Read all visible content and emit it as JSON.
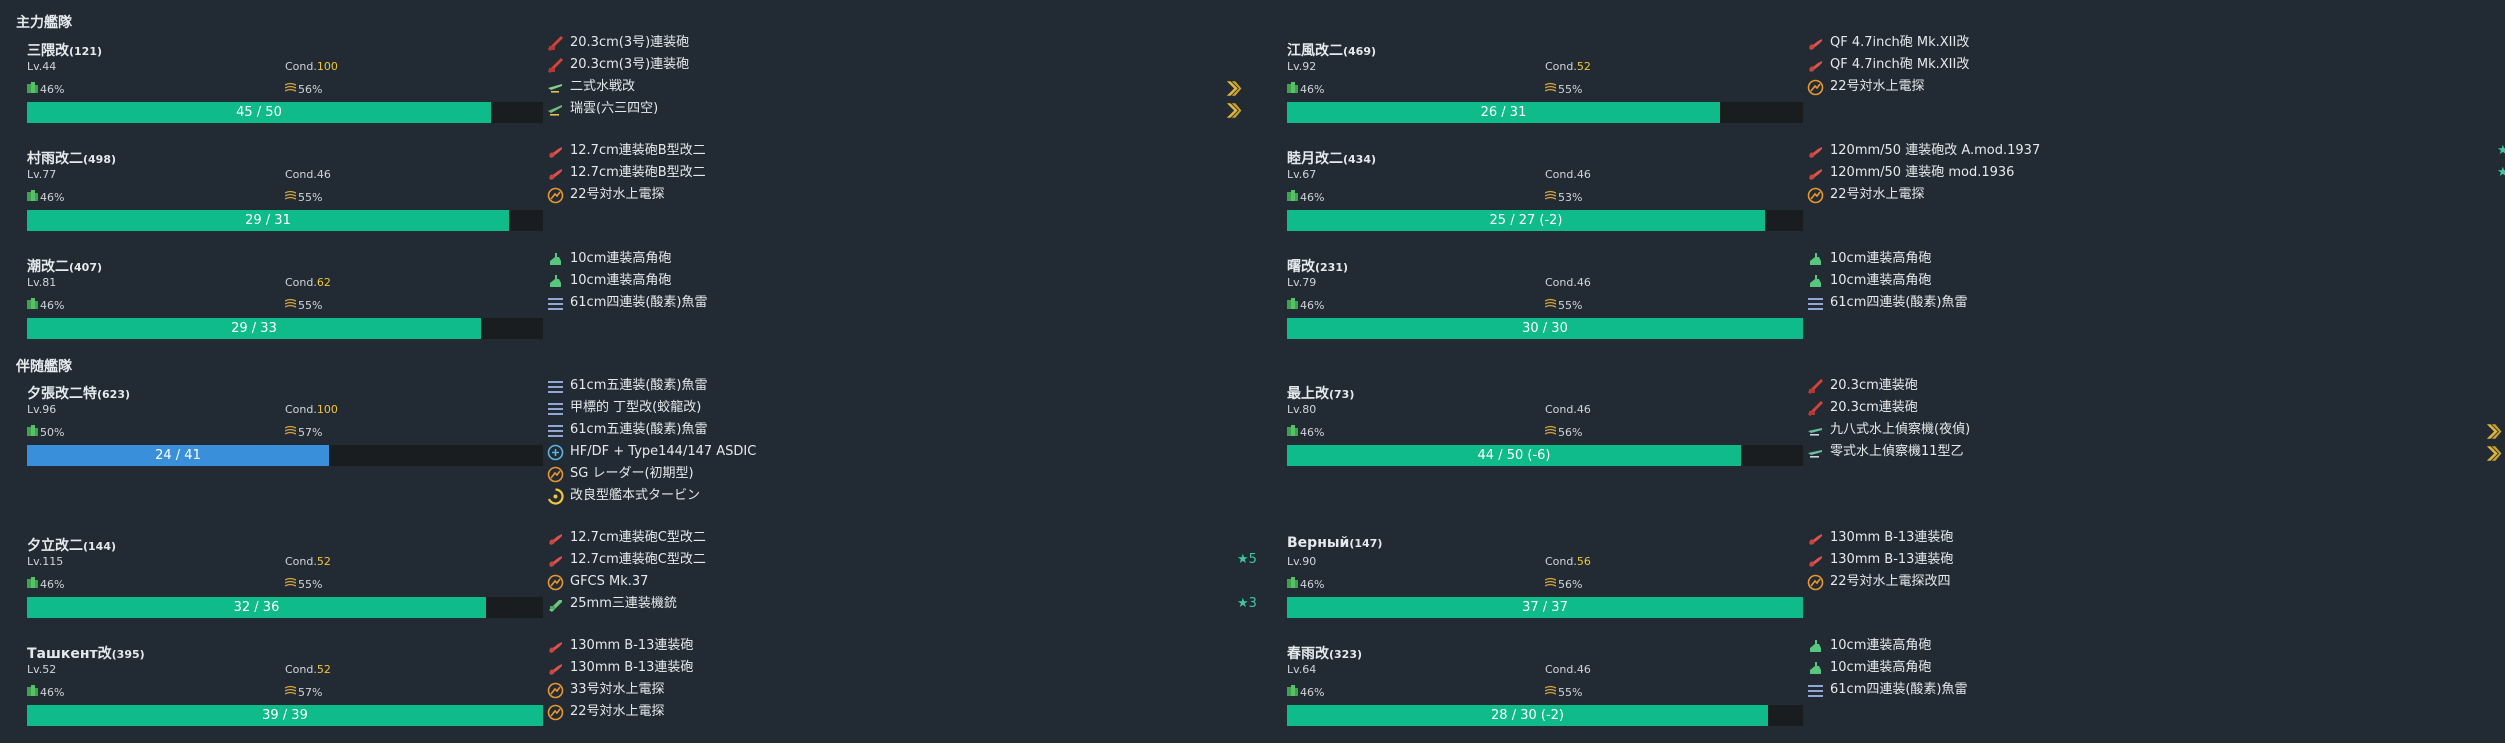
{
  "sections": {
    "main_fleet": "主力艦隊",
    "escort_fleet": "伴随艦隊"
  },
  "colors": {
    "hp_green": "#0fba8b",
    "hp_blue": "#3a8fdb",
    "cond_highlight": "#f2c53d",
    "background": "#222b33",
    "bar_track": "#1a1d20"
  },
  "labels": {
    "cond": "Cond."
  },
  "ships": [
    {
      "name": "三隈改",
      "id": "(121)",
      "lv": "Lv.44",
      "cond": "100",
      "cond_hi": true,
      "fuel": "46%",
      "ammo": "56%",
      "hp": "45 / 50",
      "hp_ratio": 0.9,
      "hp_color": "green",
      "equips": [
        {
          "icon": "main-gun-icon",
          "name": "20.3cm(3号)連装砲",
          "star": ""
        },
        {
          "icon": "main-gun-icon",
          "name": "20.3cm(3号)連装砲",
          "star": ""
        },
        {
          "icon": "seaplane-icon",
          "name": "二式水戦改",
          "star": "",
          "prof": true
        },
        {
          "icon": "seaplane-bomber-icon",
          "name": "瑞雲(六三四空)",
          "star": "",
          "prof": true
        }
      ]
    },
    {
      "name": "江風改二",
      "id": "(469)",
      "lv": "Lv.92",
      "cond": "52",
      "cond_hi": true,
      "fuel": "46%",
      "ammo": "55%",
      "hp": "26 / 31",
      "hp_ratio": 0.839,
      "hp_color": "green",
      "equips": [
        {
          "icon": "small-gun-icon",
          "name": "QF 4.7inch砲 Mk.XII改",
          "star": ""
        },
        {
          "icon": "small-gun-icon",
          "name": "QF 4.7inch砲 Mk.XII改",
          "star": ""
        },
        {
          "icon": "radar-icon",
          "name": "22号対水上電探",
          "star": ""
        }
      ]
    },
    {
      "name": "村雨改二",
      "id": "(498)",
      "lv": "Lv.77",
      "cond": "46",
      "cond_hi": false,
      "fuel": "46%",
      "ammo": "55%",
      "hp": "29 / 31",
      "hp_ratio": 0.935,
      "hp_color": "green",
      "equips": [
        {
          "icon": "small-gun-icon",
          "name": "12.7cm連装砲B型改二",
          "star": ""
        },
        {
          "icon": "small-gun-icon",
          "name": "12.7cm連装砲B型改二",
          "star": ""
        },
        {
          "icon": "radar-icon",
          "name": "22号対水上電探",
          "star": ""
        }
      ]
    },
    {
      "name": "睦月改二",
      "id": "(434)",
      "lv": "Lv.67",
      "cond": "46",
      "cond_hi": false,
      "fuel": "46%",
      "ammo": "53%",
      "hp": "25 / 27 (-2)",
      "hp_ratio": 0.926,
      "hp_color": "green",
      "equips": [
        {
          "icon": "small-gun-icon",
          "name": "120mm/50 連装砲改 A.mod.1937",
          "star": "★"
        },
        {
          "icon": "small-gun-icon",
          "name": "120mm/50 連装砲 mod.1936",
          "star": "★"
        },
        {
          "icon": "radar-icon",
          "name": "22号対水上電探",
          "star": ""
        }
      ]
    },
    {
      "name": "潮改二",
      "id": "(407)",
      "lv": "Lv.81",
      "cond": "62",
      "cond_hi": true,
      "fuel": "46%",
      "ammo": "55%",
      "hp": "29 / 33",
      "hp_ratio": 0.879,
      "hp_color": "green",
      "equips": [
        {
          "icon": "aa-gun-icon",
          "name": "10cm連装高角砲",
          "star": ""
        },
        {
          "icon": "aa-gun-icon",
          "name": "10cm連装高角砲",
          "star": ""
        },
        {
          "icon": "torpedo-icon",
          "name": "61cm四連装(酸素)魚雷",
          "star": ""
        }
      ]
    },
    {
      "name": "曙改",
      "id": "(231)",
      "lv": "Lv.79",
      "cond": "46",
      "cond_hi": false,
      "fuel": "46%",
      "ammo": "55%",
      "hp": "30 / 30",
      "hp_ratio": 1.0,
      "hp_color": "green",
      "equips": [
        {
          "icon": "aa-gun-icon",
          "name": "10cm連装高角砲",
          "star": ""
        },
        {
          "icon": "aa-gun-icon",
          "name": "10cm連装高角砲",
          "star": ""
        },
        {
          "icon": "torpedo-icon",
          "name": "61cm四連装(酸素)魚雷",
          "star": ""
        }
      ]
    },
    {
      "name": "夕張改二特",
      "id": "(623)",
      "lv": "Lv.96",
      "cond": "100",
      "cond_hi": true,
      "fuel": "50%",
      "ammo": "57%",
      "hp": "24 / 41",
      "hp_ratio": 0.585,
      "hp_color": "blue",
      "equips": [
        {
          "icon": "torpedo-icon",
          "name": "61cm五連装(酸素)魚雷",
          "star": ""
        },
        {
          "icon": "torpedo-icon",
          "name": "甲標的 丁型改(蛟龍改)",
          "star": ""
        },
        {
          "icon": "torpedo-icon",
          "name": "61cm五連装(酸素)魚雷",
          "star": ""
        },
        {
          "icon": "sonar-icon",
          "name": "HF/DF + Type144/147 ASDIC",
          "star": ""
        },
        {
          "icon": "radar-icon",
          "name": "SG レーダー(初期型)",
          "star": ""
        },
        {
          "icon": "turbine-icon",
          "name": "改良型艦本式タービン",
          "star": ""
        }
      ]
    },
    {
      "name": "最上改",
      "id": "(73)",
      "lv": "Lv.80",
      "cond": "46",
      "cond_hi": false,
      "fuel": "46%",
      "ammo": "56%",
      "hp": "44 / 50 (-6)",
      "hp_ratio": 0.88,
      "hp_color": "green",
      "equips": [
        {
          "icon": "main-gun-icon",
          "name": "20.3cm連装砲",
          "star": ""
        },
        {
          "icon": "main-gun-icon",
          "name": "20.3cm連装砲",
          "star": ""
        },
        {
          "icon": "recon-seaplane-icon",
          "name": "九八式水上偵察機(夜偵)",
          "star": "",
          "prof": true
        },
        {
          "icon": "recon-seaplane-icon",
          "name": "零式水上偵察機11型乙",
          "star": "",
          "prof": true
        }
      ]
    },
    {
      "name": "夕立改二",
      "id": "(144)",
      "lv": "Lv.115",
      "cond": "52",
      "cond_hi": true,
      "fuel": "46%",
      "ammo": "55%",
      "hp": "32 / 36",
      "hp_ratio": 0.889,
      "hp_color": "green",
      "equips": [
        {
          "icon": "small-gun-icon",
          "name": "12.7cm連装砲C型改二",
          "star": ""
        },
        {
          "icon": "small-gun-icon",
          "name": "12.7cm連装砲C型改二",
          "star": "★5"
        },
        {
          "icon": "radar-icon",
          "name": "GFCS Mk.37",
          "star": ""
        },
        {
          "icon": "machine-gun-icon",
          "name": "25mm三連装機銃",
          "star": "★3"
        }
      ]
    },
    {
      "name": "Верный",
      "id": "(147)",
      "lv": "Lv.90",
      "cond": "56",
      "cond_hi": true,
      "fuel": "46%",
      "ammo": "56%",
      "hp": "37 / 37",
      "hp_ratio": 1.0,
      "hp_color": "green",
      "equips": [
        {
          "icon": "small-gun-icon",
          "name": "130mm B-13連装砲",
          "star": ""
        },
        {
          "icon": "small-gun-icon",
          "name": "130mm B-13連装砲",
          "star": ""
        },
        {
          "icon": "radar-icon",
          "name": "22号対水上電探改四",
          "star": ""
        }
      ]
    },
    {
      "name": "Ташкент改",
      "id": "(395)",
      "lv": "Lv.52",
      "cond": "52",
      "cond_hi": true,
      "fuel": "46%",
      "ammo": "57%",
      "hp": "39 / 39",
      "hp_ratio": 1.0,
      "hp_color": "green",
      "equips": [
        {
          "icon": "small-gun-icon",
          "name": "130mm B-13連装砲",
          "star": ""
        },
        {
          "icon": "small-gun-icon",
          "name": "130mm B-13連装砲",
          "star": ""
        },
        {
          "icon": "radar-icon",
          "name": "33号対水上電探",
          "star": ""
        },
        {
          "icon": "radar-icon",
          "name": "22号対水上電探",
          "star": ""
        }
      ]
    },
    {
      "name": "春雨改",
      "id": "(323)",
      "lv": "Lv.64",
      "cond": "46",
      "cond_hi": false,
      "fuel": "46%",
      "ammo": "55%",
      "hp": "28 / 30 (-2)",
      "hp_ratio": 0.933,
      "hp_color": "green",
      "equips": [
        {
          "icon": "aa-gun-icon",
          "name": "10cm連装高角砲",
          "star": ""
        },
        {
          "icon": "aa-gun-icon",
          "name": "10cm連装高角砲",
          "star": ""
        },
        {
          "icon": "torpedo-icon",
          "name": "61cm四連装(酸素)魚雷",
          "star": ""
        }
      ]
    }
  ]
}
